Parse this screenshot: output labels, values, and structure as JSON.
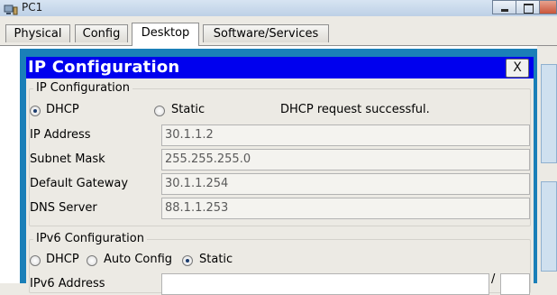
{
  "window": {
    "title": "PC1"
  },
  "tabs": [
    {
      "label": "Physical"
    },
    {
      "label": "Config"
    },
    {
      "label": "Desktop"
    },
    {
      "label": "Software/Services"
    }
  ],
  "dialog": {
    "title": "IP Configuration",
    "close_label": "X",
    "ipv4": {
      "legend": "IP Configuration",
      "dhcp_label": "DHCP",
      "static_label": "Static",
      "selected_mode": "DHCP",
      "status": "DHCP request successful.",
      "fields": [
        {
          "label": "IP Address",
          "value": "30.1.1.2"
        },
        {
          "label": "Subnet Mask",
          "value": "255.255.255.0"
        },
        {
          "label": "Default Gateway",
          "value": "30.1.1.254"
        },
        {
          "label": "DNS Server",
          "value": "88.1.1.253"
        }
      ]
    },
    "ipv6": {
      "legend": "IPv6 Configuration",
      "dhcp_label": "DHCP",
      "autoconfig_label": "Auto Config",
      "static_label": "Static",
      "selected_mode": "Static",
      "address_label": "IPv6 Address",
      "address_separator": "/"
    }
  },
  "colors": {
    "dialog_frame": "#1a7fb8",
    "title_bar": "#0000ee",
    "panel_bg": "#eceae4"
  }
}
